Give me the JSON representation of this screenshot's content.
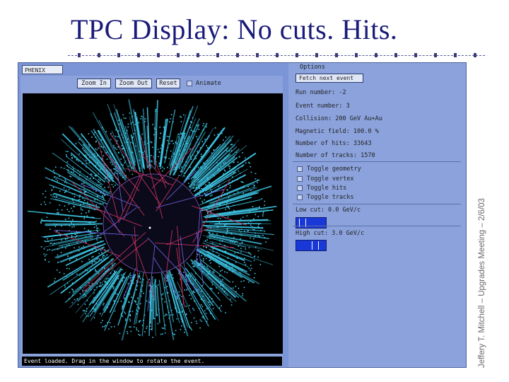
{
  "slide": {
    "title": "TPC Display: No cuts. Hits.",
    "side_caption": "Jeffery T. Mitchell – Upgrades Meeting – 2/6/03"
  },
  "app": {
    "tab_label": "PHENIX",
    "toolbar": {
      "zoom_in_label": "Zoom In",
      "zoom_out_label": "Zoom Out",
      "reset_label": "Reset",
      "animate_label": "Animate",
      "animate_checked": false
    },
    "status_text": "Event loaded. Drag in the window to rotate the event.",
    "options": {
      "header": "Options",
      "fetch_button_label": "Fetch next event",
      "info": [
        "Run number: -2",
        "Event number: 3",
        "Collision: 200 GeV Au+Au",
        "Magnetic field: 100.0 %",
        "Number of hits: 33643",
        "Number of tracks: 1570"
      ],
      "toggles": [
        {
          "label": "Toggle geometry",
          "checked": false
        },
        {
          "label": "Toggle vertex",
          "checked": false
        },
        {
          "label": "Toggle hits",
          "checked": false
        },
        {
          "label": "Toggle tracks",
          "checked": false
        }
      ],
      "low_cut_label": "Low cut: 0.0 GeV/c",
      "high_cut_label": "High cut: 3.0 GeV/c"
    }
  },
  "colors": {
    "panel": "#8ba2dc",
    "hits": "#3ec8e8",
    "tracks": "#c03060",
    "slider": "#1a38d8"
  }
}
